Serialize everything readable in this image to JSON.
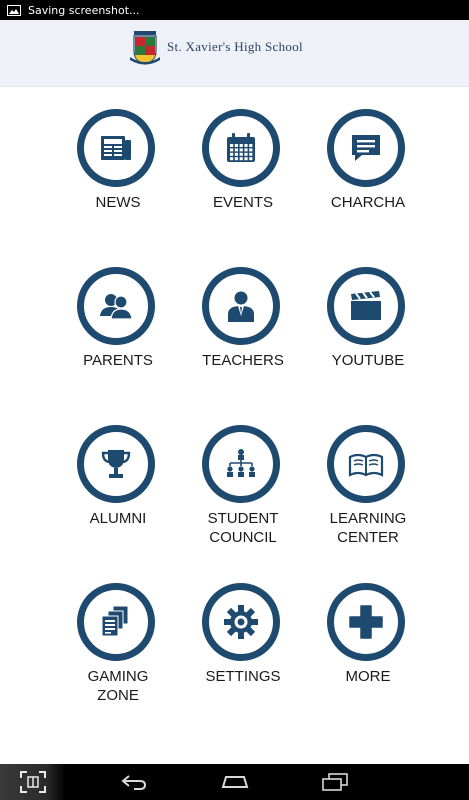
{
  "status_bar": {
    "notification_text": "Saving screenshot..."
  },
  "header": {
    "school_name": "St. Xavier's High School"
  },
  "tiles": [
    {
      "label_lines": [
        "NEWS"
      ],
      "icon": "newspaper-icon"
    },
    {
      "label_lines": [
        "EVENTS"
      ],
      "icon": "calendar-icon"
    },
    {
      "label_lines": [
        "CHARCHA"
      ],
      "icon": "chat-bubble-icon"
    },
    {
      "label_lines": [
        "PARENTS"
      ],
      "icon": "parents-icon"
    },
    {
      "label_lines": [
        "TEACHERS"
      ],
      "icon": "teacher-icon"
    },
    {
      "label_lines": [
        "YOUTUBE"
      ],
      "icon": "clapperboard-icon"
    },
    {
      "label_lines": [
        "ALUMNI"
      ],
      "icon": "trophy-icon"
    },
    {
      "label_lines": [
        "STUDENT",
        "COUNCIL"
      ],
      "icon": "hierarchy-icon"
    },
    {
      "label_lines": [
        "LEARNING",
        "CENTER"
      ],
      "icon": "open-book-icon"
    },
    {
      "label_lines": [
        "GAMING",
        "ZONE"
      ],
      "icon": "documents-icon"
    },
    {
      "label_lines": [
        "SETTINGS"
      ],
      "icon": "gear-icon"
    },
    {
      "label_lines": [
        "MORE"
      ],
      "icon": "plus-icon"
    }
  ],
  "colors": {
    "primary": "#1e4a70",
    "header_bg": "#eef2f8",
    "school_name": "#2c4364"
  },
  "nav_bar": {
    "buttons": [
      "screenshot-icon",
      "back-icon",
      "home-icon",
      "recent-apps-icon"
    ]
  }
}
